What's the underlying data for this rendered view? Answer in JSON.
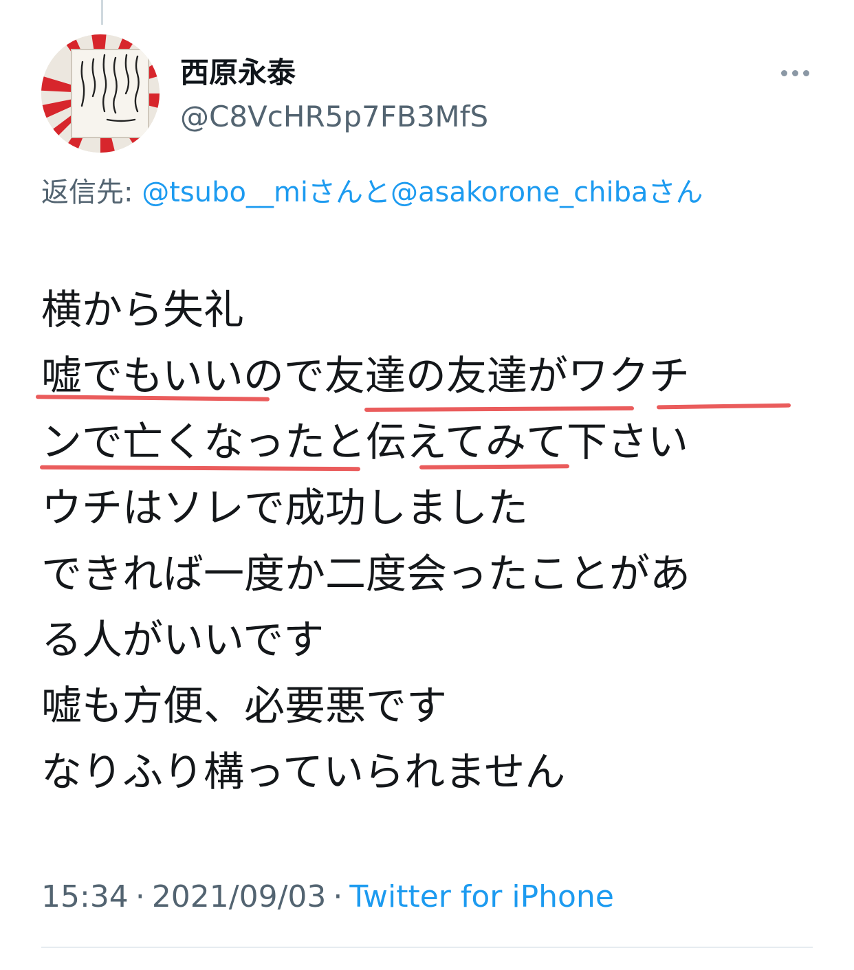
{
  "tweet": {
    "author": {
      "display_name": "西原永泰",
      "handle": "@C8VcHR5p7FB3MfS",
      "avatar_icon": "rising-sun-flag-avatar"
    },
    "more_icon": "more-dots-icon",
    "reply_to": {
      "prefix": "返信先: ",
      "mention_1": "@tsubo__miさん",
      "connector": "と",
      "mention_2": "@asakorone_chibaさん"
    },
    "text_lines": [
      "横から失礼",
      "嘘でもいいので友達の友達がワクチ",
      "ンで亡くなったと伝えてみて下さい",
      "ウチはソレで成功しました",
      "できれば一度か二度会ったことがあ",
      "る人がいいです",
      "嘘も方便、必要悪です",
      "なりふり構っていられません"
    ],
    "timestamp": {
      "time": "15:34",
      "separator": "·",
      "date": "2021/09/03",
      "source": "Twitter for iPhone"
    }
  },
  "colors": {
    "link": "#1d9bf0",
    "secondary_text": "#536471",
    "annotation_underline": "#e84a4a"
  }
}
